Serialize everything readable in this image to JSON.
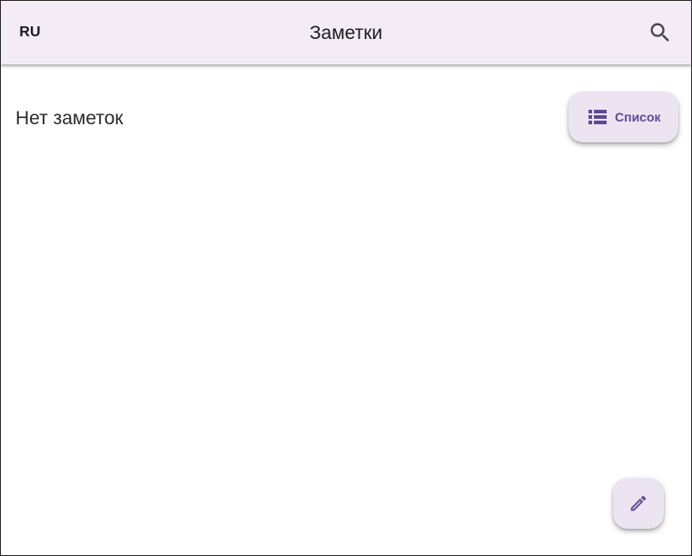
{
  "app_bar": {
    "language_label": "RU",
    "title": "Заметки",
    "search_icon": "search-icon"
  },
  "main": {
    "empty_message": "Нет заметок",
    "view_toggle": {
      "label": "Список",
      "icon": "list-icon"
    }
  },
  "fab": {
    "icon": "edit-icon"
  },
  "colors": {
    "app_bar_background": "#f3ecf6",
    "button_surface": "#ece4f1",
    "accent": "#5e4a93",
    "text_primary": "#1d1b20"
  }
}
